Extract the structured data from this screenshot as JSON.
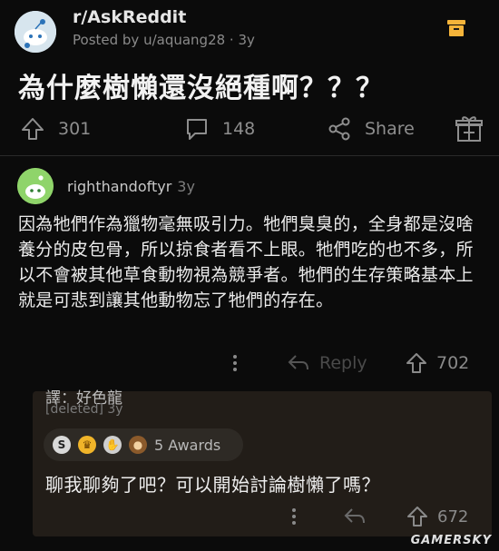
{
  "header": {
    "subreddit": "r/AskReddit",
    "posted_by": "Posted by u/aquang28 · 3y"
  },
  "post": {
    "title": "為什麼樹懶還沒絕種啊？？？",
    "upvotes": "301",
    "comments": "148",
    "share_label": "Share"
  },
  "comment": {
    "author": "righthandoftyr",
    "age": "3y",
    "body": "因為牠們作為獵物毫無吸引力。牠們臭臭的，全身都是沒啥養分的皮包骨，所以掠食者看不上眼。牠們吃的也不多，所以不會被其他草食動物視為競爭者。牠們的生存策略基本上就是可悲到讓其他動物忘了牠們的存在。",
    "reply_label": "Reply",
    "votes": "702"
  },
  "reply": {
    "translator_note": "譯：好色龍",
    "author": "[deleted] 3y",
    "awards_label": "5 Awards",
    "body": "聊我聊夠了吧？可以開始討論樹懶了嗎？",
    "votes": "672"
  },
  "watermark": "GAMERSKY",
  "colors": {
    "background": "#0b0b0b",
    "reply_box": "#221d18",
    "save_icon": "#f5b43a",
    "award_silver": "#d9d9d9",
    "award_gold": "#f0b429"
  }
}
